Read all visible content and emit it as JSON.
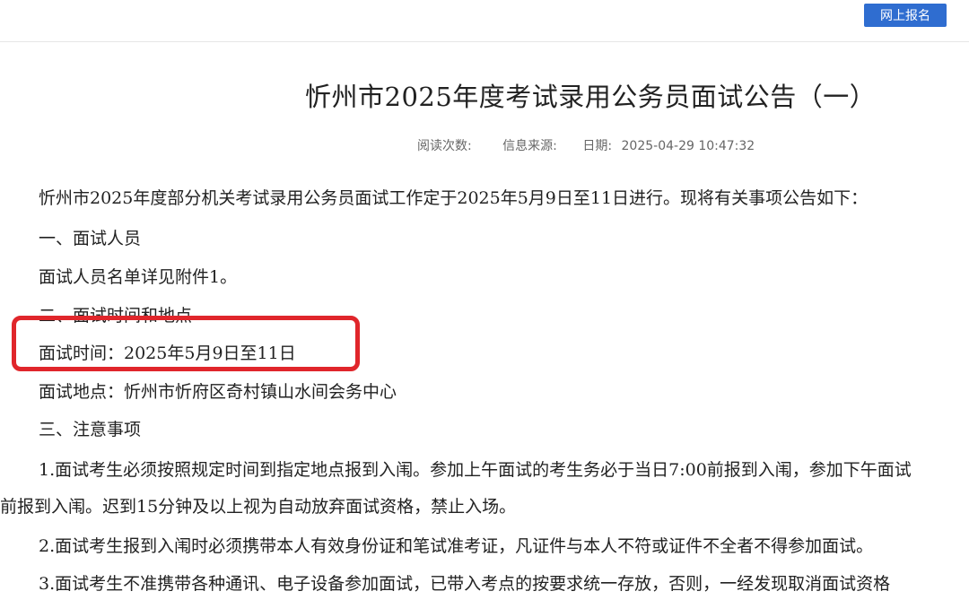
{
  "header": {
    "online_signup_label": "网上报名"
  },
  "article": {
    "title": "忻州市2025年度考试录用公务员面试公告（一）",
    "meta": {
      "reads_label": "阅读次数:",
      "source_label": "信息来源:",
      "date_label": "日期:",
      "date_value": "2025-04-29 10:47:32"
    },
    "intro": "忻州市2025年度部分机关考试录用公务员面试工作定于2025年5月9日至11日进行。现将有关事项公告如下：",
    "section1_heading": "一、面试人员",
    "section1_text": "面试人员名单详见附件1。",
    "section2_heading": "二、面试时间和地点",
    "interview_time": "面试时间：2025年5月9日至11日",
    "interview_place": "面试地点：忻州市忻府区奇村镇山水间会务中心",
    "section3_heading": "三、注意事项",
    "note1_line1": "1.面试考生必须按照规定时间到指定地点报到入闱。参加上午面试的考生务必于当日7:00前报到入闱，参加下午面试",
    "note1_line2": "前报到入闱。迟到15分钟及以上视为自动放弃面试资格，禁止入场。",
    "note2": "2.面试考生报到入闱时必须携带本人有效身份证和笔试准考证，凡证件与本人不符或证件不全者不得参加面试。",
    "note3": "3.面试考生不准携带各种通讯、电子设备参加面试，已带入考点的按要求统一存放，否则，一经发现取消面试资格"
  },
  "colors": {
    "button_blue": "#2f6dd0",
    "highlight_red": "#e0262b"
  }
}
